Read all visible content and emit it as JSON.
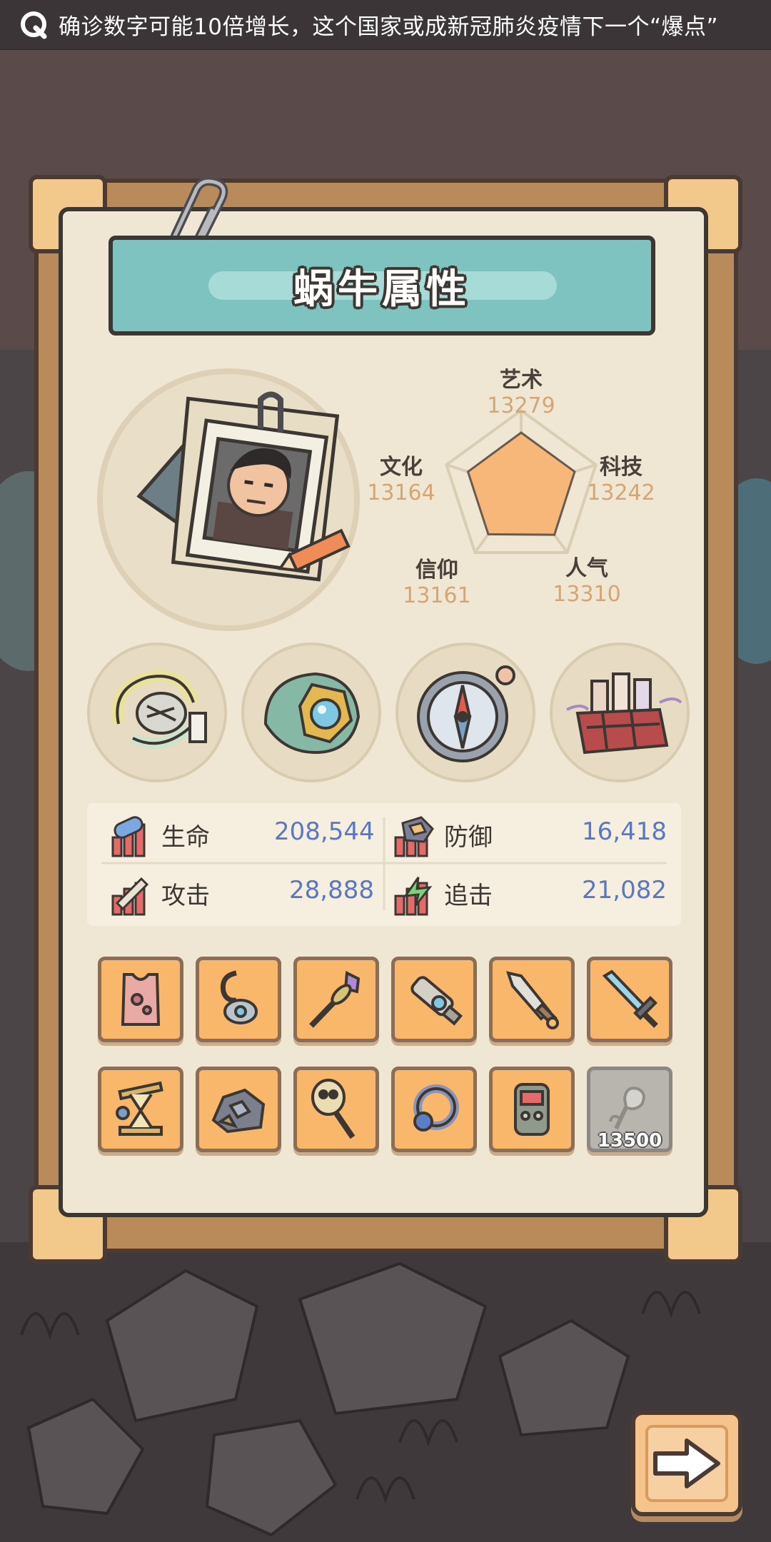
{
  "notification": {
    "icon": "q-logo-icon",
    "text": "确诊数字可能10倍增长，这个国家或成新冠肺炎疫情下一个“爆点”"
  },
  "panel": {
    "title": "蜗牛属性"
  },
  "attributes": [
    {
      "label": "艺术",
      "value": "13279"
    },
    {
      "label": "科技",
      "value": "13242"
    },
    {
      "label": "人气",
      "value": "13310"
    },
    {
      "label": "信仰",
      "value": "13161"
    },
    {
      "label": "文化",
      "value": "13164"
    }
  ],
  "equipment": [
    {
      "icon": "shell-fossil-icon"
    },
    {
      "icon": "gem-helmet-icon"
    },
    {
      "icon": "compass-icon"
    },
    {
      "icon": "potion-crate-icon"
    }
  ],
  "combat_stats": [
    {
      "label": "生命",
      "value": "208,544",
      "icon": "health-pill-icon"
    },
    {
      "label": "防御",
      "value": "16,418",
      "icon": "defense-shield-icon"
    },
    {
      "label": "攻击",
      "value": "28,888",
      "icon": "attack-sword-icon"
    },
    {
      "label": "追击",
      "value": "21,082",
      "icon": "pursuit-bolt-icon"
    }
  ],
  "items": [
    {
      "icon": "vest-armor-icon"
    },
    {
      "icon": "hook-earring-icon"
    },
    {
      "icon": "crystal-scepter-icon"
    },
    {
      "icon": "blaster-gun-icon"
    },
    {
      "icon": "rocket-dagger-icon"
    },
    {
      "icon": "crystal-sword-icon"
    },
    {
      "icon": "hourglass-bolas-icon"
    },
    {
      "icon": "ore-rock-icon"
    },
    {
      "icon": "skull-staff-icon"
    },
    {
      "icon": "gem-ring-icon"
    },
    {
      "icon": "gadget-device-icon"
    },
    {
      "icon": "rose-locked-icon",
      "cost": "13500",
      "locked": true
    }
  ],
  "next_button": {
    "icon": "arrow-right-icon"
  },
  "colors": {
    "banner": "#7fc3c0",
    "stat_value": "#5a77c4",
    "attribute_value": "#d6a574",
    "item_slot": "#f9b76b"
  }
}
